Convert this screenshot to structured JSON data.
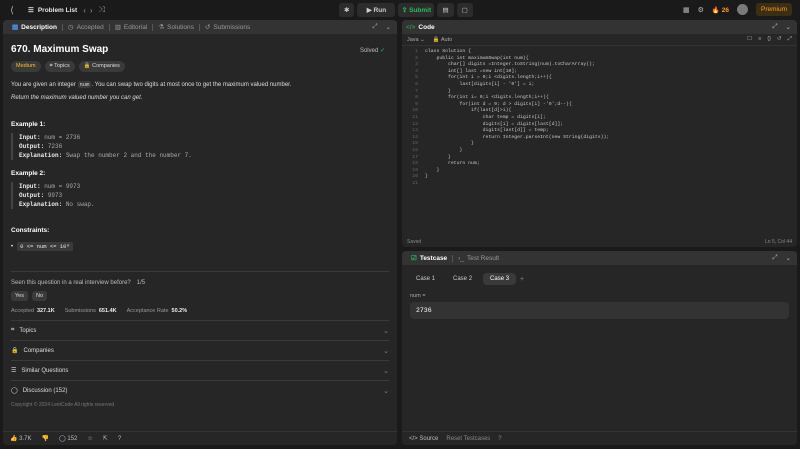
{
  "topbar": {
    "problem_list": "Problem List",
    "run": "Run",
    "submit": "Submit",
    "streak": "26",
    "premium": "Premium"
  },
  "left": {
    "tabs": [
      "Description",
      "Accepted",
      "Editorial",
      "Solutions",
      "Submissions"
    ],
    "title": "670. Maximum Swap",
    "solved": "Solved",
    "tags": [
      "Medium",
      "Topics",
      "Companies"
    ],
    "desc_pre": "You are given an integer ",
    "desc_code": "num",
    "desc_post": ". You can swap two digits at most once to get the maximum valued number.",
    "desc_italic": "Return the maximum valued number you can get.",
    "example1_title": "Example 1:",
    "example1": {
      "input_label": "Input:",
      "input": "num = 2736",
      "output_label": "Output:",
      "output": "7236",
      "expl_label": "Explanation:",
      "expl": "Swap the number 2 and the number 7."
    },
    "example2_title": "Example 2:",
    "example2": {
      "input_label": "Input:",
      "input": "num = 9973",
      "output_label": "Output:",
      "output": "9973",
      "expl_label": "Explanation:",
      "expl": "No swap."
    },
    "constraints_title": "Constraints:",
    "constraint": "0 <= num <= 10⁸",
    "interview_q": "Seen this question in a real interview before?",
    "interview_count": "1/5",
    "yes": "Yes",
    "no": "No",
    "accepted_label": "Accepted",
    "accepted": "327.1K",
    "submissions_label": "Submissions",
    "submissions": "651.4K",
    "rate_label": "Acceptance Rate",
    "rate": "50.2%",
    "accordions": [
      "Topics",
      "Companies",
      "Similar Questions",
      "Discussion (152)"
    ],
    "copyright": "Copyright © 2024 LeetCode All rights reserved",
    "likes": "3.7K",
    "comments": "152"
  },
  "code": {
    "header": "Code",
    "language": "Java",
    "auto": "Auto",
    "lines": [
      "class Solution {",
      "    public int maximumSwap(int num){",
      "        char[] digits =Integer.toString(num).toCharArray();",
      "        int[] last =new int[10];",
      "        for(int i = 0;i <digits.length;i++){",
      "            last[digits[i] - '0'] = i;",
      "        }",
      "        for(int i= 0;i <digits.length;i++){",
      "            for(int d = 9; d > digits[i] -'0';d--){",
      "                if(last[d]>i){",
      "                    char temp = digits[i];",
      "                    digits[i] = digits[last[d]];",
      "                    digits[last[d]] = temp;",
      "                    return Integer.parseInt(new String(digits));",
      "                }",
      "            }",
      "        }",
      "        return num;",
      "    }",
      "}",
      ""
    ],
    "saved": "Saved",
    "position": "Ln 5, Col 44"
  },
  "test": {
    "tab_testcase": "Testcase",
    "tab_result": "Test Result",
    "cases": [
      "Case 1",
      "Case 2",
      "Case 3"
    ],
    "var_label": "num =",
    "var_value": "2736",
    "source": "Source",
    "reset": "Reset Testcases"
  },
  "colors": {
    "accent": "#ffa116",
    "green": "#2cbb5d",
    "medium": "#ffc01e"
  }
}
